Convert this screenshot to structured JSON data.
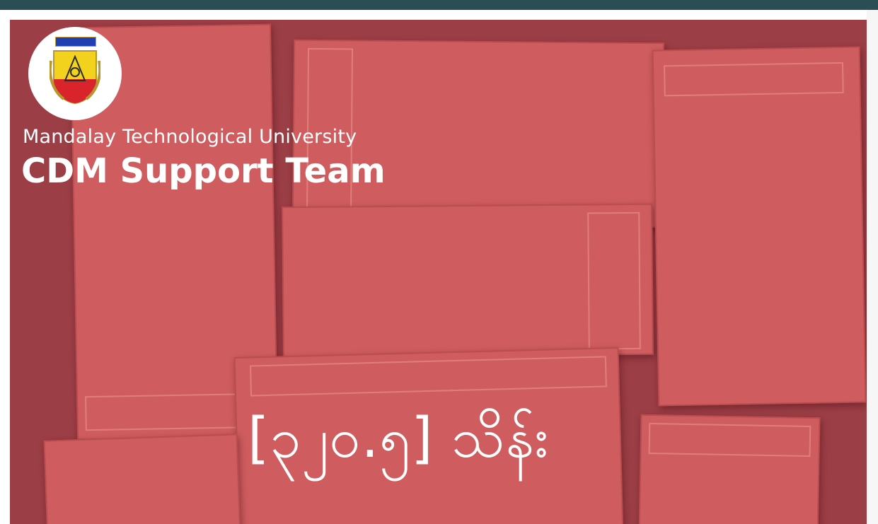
{
  "image": {
    "caption_lines": {
      "university": "Mandalay Technological University",
      "team": "CDM Support Team",
      "bottom_text": "[၃၂၀.၅] သိန်း"
    },
    "logo": {
      "icon": "university-shield-logo"
    },
    "colors": {
      "overlay_red": "#cf5d5f",
      "background_dark": "#2a3f44",
      "text": "#ffffff",
      "shield_blue": "#1f3fb3",
      "shield_yellow": "#f2d21c",
      "shield_red": "#d8242a"
    }
  }
}
